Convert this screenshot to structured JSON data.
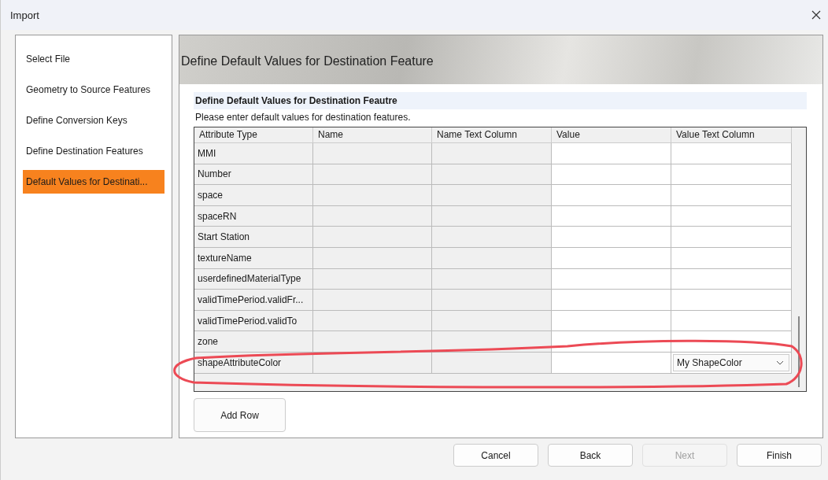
{
  "window": {
    "title": "Import"
  },
  "sidebar": {
    "items": [
      {
        "label": "Select File",
        "selected": false
      },
      {
        "label": "Geometry to Source Features",
        "selected": false
      },
      {
        "label": "Define Conversion Keys",
        "selected": false
      },
      {
        "label": "Define Destination Features",
        "selected": false
      },
      {
        "label": "Default Values for Destinati...",
        "selected": true
      }
    ]
  },
  "header": {
    "title": "Define Default Values for Destination Feature"
  },
  "section": {
    "title": "Define Default Values for Destination Feautre",
    "description": "Please enter default values for destination features."
  },
  "table": {
    "columns": [
      "Attribute Type",
      "Name",
      "Name Text Column",
      "Value",
      "Value Text Column"
    ],
    "rows": [
      {
        "attribute_type": "MMI"
      },
      {
        "attribute_type": "Number"
      },
      {
        "attribute_type": "space"
      },
      {
        "attribute_type": "spaceRN"
      },
      {
        "attribute_type": "Start Station"
      },
      {
        "attribute_type": "textureName"
      },
      {
        "attribute_type": "userdefinedMaterialType"
      },
      {
        "attribute_type": "validTimePeriod.validFr..."
      },
      {
        "attribute_type": "validTimePeriod.validTo"
      },
      {
        "attribute_type": "zone"
      },
      {
        "attribute_type": "shapeAttributeColor",
        "value_text_column": {
          "kind": "dropdown",
          "value": "My ShapeColor"
        }
      }
    ]
  },
  "add_row_button": "Add Row",
  "buttons": [
    {
      "label": "Cancel",
      "disabled": false
    },
    {
      "label": "Back",
      "disabled": false
    },
    {
      "label": "Next",
      "disabled": true
    },
    {
      "label": "Finish",
      "disabled": false
    }
  ]
}
